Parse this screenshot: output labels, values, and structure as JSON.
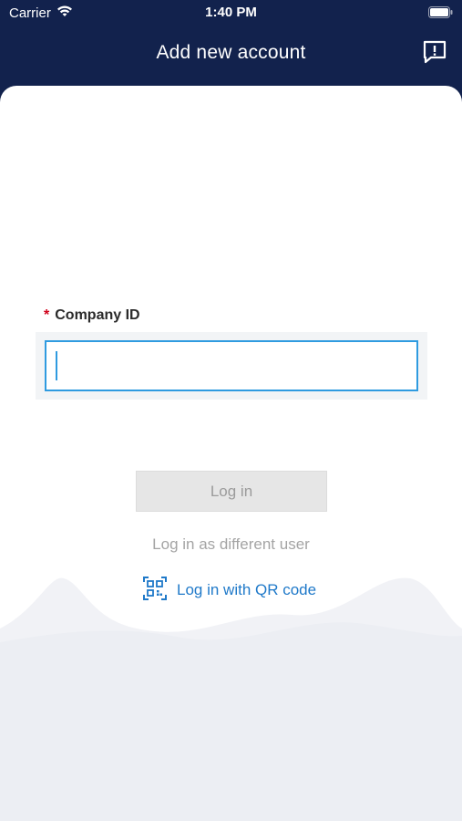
{
  "status_bar": {
    "carrier": "Carrier",
    "time": "1:40 PM"
  },
  "header": {
    "title": "Add new account",
    "feedback_icon": "feedback-icon"
  },
  "form": {
    "required_marker": "*",
    "company_id_label": "Company ID",
    "company_id_value": "",
    "company_id_placeholder": ""
  },
  "actions": {
    "login_label": "Log in",
    "different_user_label": "Log in as different user",
    "qr_label": "Log in with QR code",
    "qr_icon": "qr-code-icon"
  },
  "colors": {
    "header_bg": "#12224d",
    "accent": "#2f9be0",
    "link": "#1f79c9",
    "required": "#d0021b",
    "disabled_button": "#e6e6e6"
  }
}
